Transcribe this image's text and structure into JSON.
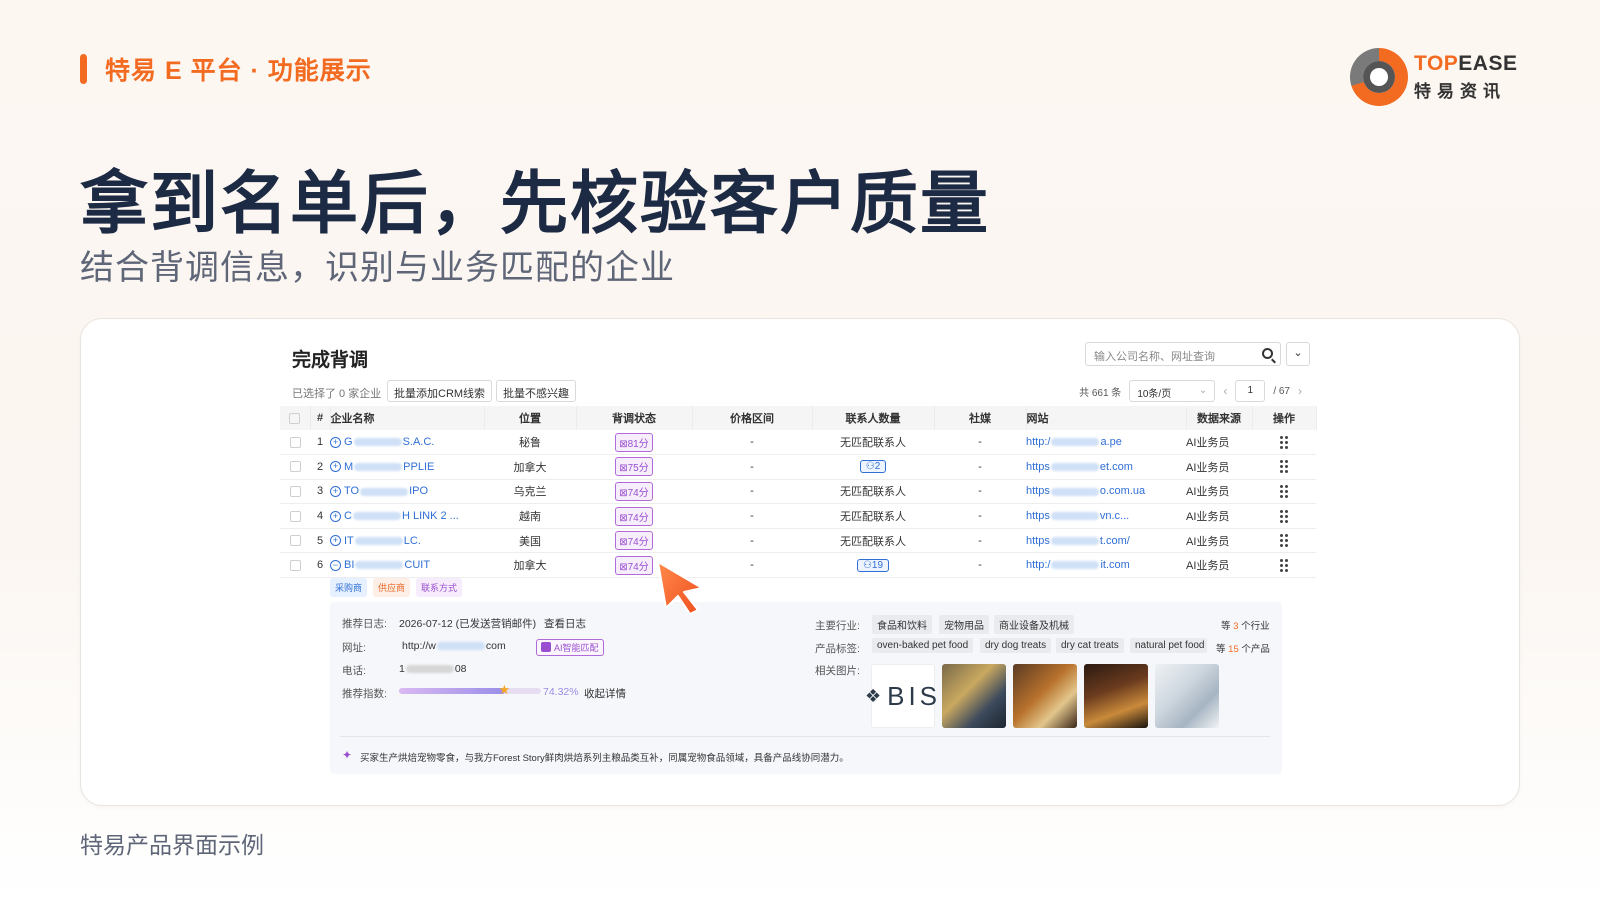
{
  "slide": {
    "section_tag": "特易 E 平台 · 功能展示",
    "headline": "拿到名单后，先核验客户质量",
    "subheadline": "结合背调信息，识别与业务匹配的企业",
    "caption": "特易产品界面示例",
    "accent_color": "#f26b21"
  },
  "logo": {
    "en_top": "TOP",
    "en_rest": "EASE",
    "cn": "特易资讯",
    "icon": "ring-logo-icon"
  },
  "app": {
    "title": "完成背调",
    "search_placeholder": "输入公司名称、网址查询",
    "dropdown_glyph": "⌄",
    "selected_info": "已选择了 0 家企业",
    "btn_add_crm": "批量添加CRM线索",
    "btn_not_interested": "批量不感兴趣",
    "total": "共 661 条",
    "page_size": "10条/页",
    "page_current": "1",
    "page_total": "/ 67",
    "columns": [
      "#",
      "企业名称",
      "位置",
      "背调状态",
      "价格区间",
      "联系人数量",
      "社媒",
      "网站",
      "数据来源",
      "操作"
    ],
    "rows": [
      {
        "no": "1",
        "name_start": "G",
        "name_end": "S.A.C.",
        "location": "秘鲁",
        "score": "81分",
        "price": "-",
        "contacts": "无匹配联系人",
        "contact_count": "",
        "social": "-",
        "site_start": "http:/",
        "site_end": "a.pe",
        "source": "AI业务员",
        "expand": "+"
      },
      {
        "no": "2",
        "name_start": "M",
        "name_end": "PPLIE",
        "location": "加拿大",
        "score": "75分",
        "price": "-",
        "contacts": "",
        "contact_count": "2",
        "social": "-",
        "site_start": "https",
        "site_end": "et.com",
        "source": "AI业务员",
        "expand": "+"
      },
      {
        "no": "3",
        "name_start": "TO",
        "name_end": "IPO",
        "location": "乌克兰",
        "score": "74分",
        "price": "-",
        "contacts": "无匹配联系人",
        "contact_count": "",
        "social": "-",
        "site_start": "https",
        "site_end": "o.com.ua",
        "source": "AI业务员",
        "expand": "+"
      },
      {
        "no": "4",
        "name_start": "C",
        "name_end": "H LINK 2 ...",
        "location": "越南",
        "score": "74分",
        "price": "-",
        "contacts": "无匹配联系人",
        "contact_count": "",
        "social": "-",
        "site_start": "https",
        "site_end": "vn.c...",
        "source": "AI业务员",
        "expand": "+"
      },
      {
        "no": "5",
        "name_start": "IT",
        "name_end": "LC.",
        "location": "美国",
        "score": "74分",
        "price": "-",
        "contacts": "无匹配联系人",
        "contact_count": "",
        "social": "-",
        "site_start": "https",
        "site_end": "t.com/",
        "source": "AI业务员",
        "expand": "+"
      },
      {
        "no": "6",
        "name_start": "BI",
        "name_end": "CUIT",
        "location": "加拿大",
        "score": "74分",
        "price": "-",
        "contacts": "",
        "contact_count": "19",
        "social": "-",
        "site_start": "http:/",
        "site_end": "it.com",
        "source": "AI业务员",
        "expand": "−"
      }
    ],
    "row_tags": [
      "采购商",
      "供应商",
      "联系方式"
    ],
    "detail": {
      "log_label": "推荐日志:",
      "log_date": "2026-07-12 (已发送营销邮件)",
      "log_link": "查看日志",
      "site_label": "网址:",
      "site_start": "http://w",
      "site_end": "com",
      "ai_badge": "AI智能匹配",
      "phone_label": "电话:",
      "phone_start": "1",
      "phone_end": "08",
      "index_label": "推荐指数:",
      "index_value": "74.32%",
      "index_fraction": 0.7432,
      "index_link": "收起详情",
      "industry_label": "主要行业:",
      "industries": [
        "食品和饮料",
        "宠物用品",
        "商业设备及机械"
      ],
      "industry_more_pre": "等",
      "industry_more_num": "3",
      "industry_more_post": "个行业",
      "tag_label": "产品标签:",
      "product_tags": [
        "oven-baked pet food",
        "dry dog treats",
        "dry cat treats",
        "natural pet food"
      ],
      "product_more_pre": "等",
      "product_more_num": "15",
      "product_more_post": "个产品",
      "images_label": "相关图片:",
      "image_logo_text": "BIS",
      "summary": "买家生产烘焙宠物零食，与我方Forest Story鲜肉烘焙系列主粮品类互补，同属宠物食品领域，具备产品线协同潜力。"
    }
  }
}
